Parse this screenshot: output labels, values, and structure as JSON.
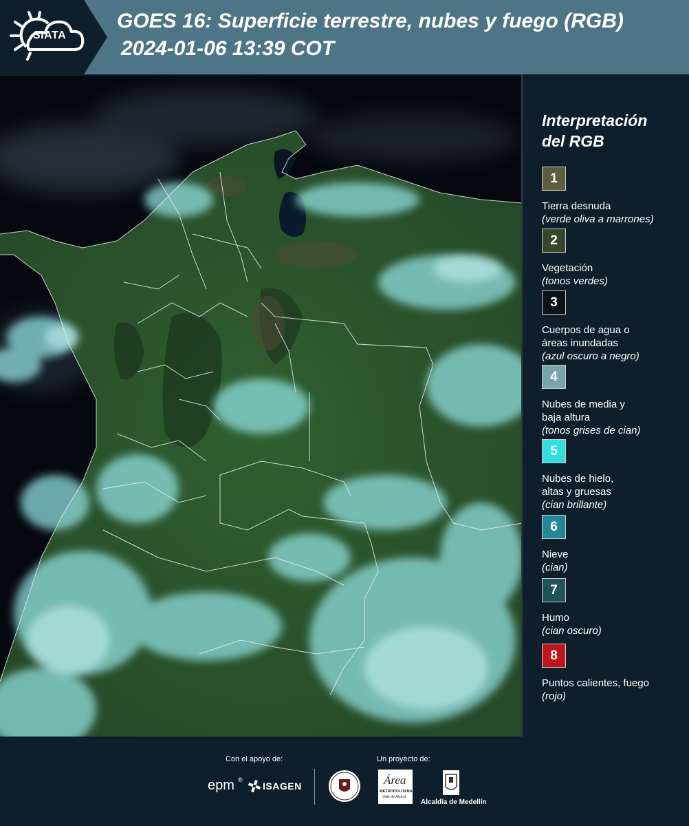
{
  "header": {
    "logo_text": "SIATA",
    "title_line1": "GOES 16: Superficie terrestre, nubes y fuego (RGB)",
    "title_line2": "2024-01-06 13:39 COT"
  },
  "legend": {
    "title_line1": "Interpretación",
    "title_line2": "del RGB",
    "items": [
      {
        "number": "1",
        "color": "#5c5c3f",
        "label": "Tierra desnuda",
        "sub": "(verde oliva a marrones)"
      },
      {
        "number": "2",
        "color": "#36472a",
        "label": "Vegetación",
        "sub": "(tonos verdes)"
      },
      {
        "number": "3",
        "color": "#0d1216",
        "label": "Cuerpos de agua o áreas inundadas",
        "sub": "(azul oscuro a negro)"
      },
      {
        "number": "4",
        "color": "#7aa5a8",
        "label": "Nubes de media y baja altura",
        "sub": "(tonos grises de cian)"
      },
      {
        "number": "5",
        "color": "#33dede",
        "label": "Nubes de hielo, altas y gruesas",
        "sub": "(cian brillante)"
      },
      {
        "number": "6",
        "color": "#23879a",
        "label": "Nieve",
        "sub": "(cian)"
      },
      {
        "number": "7",
        "color": "#1f5355",
        "label": "Humo",
        "sub": "(cian oscuro)"
      },
      {
        "number": "8",
        "color": "#c0161b",
        "label": "Puntos calientes, fuego",
        "sub": "(rojo)"
      }
    ]
  },
  "footer": {
    "support_label": "Con el apoyo de:",
    "project_label": "Un proyecto de:",
    "epm": "epm",
    "isagen": "ISAGEN",
    "area_line1": "Área",
    "area_line2": "METROPOLITANA",
    "area_line3": "Valle de Aburrá",
    "medellin": "Alcaldía de Medellín"
  },
  "map": {
    "description_colors": {
      "ocean": "#050a12",
      "vegetation": "#2e5a2e",
      "cloud": "#7fd6d6"
    }
  }
}
